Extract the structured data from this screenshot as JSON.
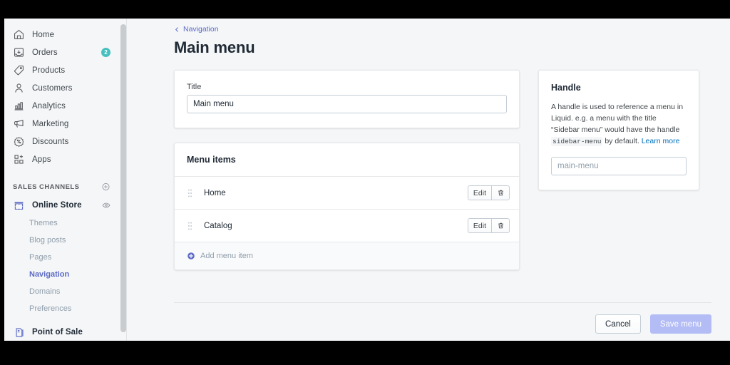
{
  "sidebar": {
    "nav_items": [
      {
        "label": "Home",
        "icon": "home-icon",
        "badge": null
      },
      {
        "label": "Orders",
        "icon": "orders-icon",
        "badge": "2"
      },
      {
        "label": "Products",
        "icon": "products-tag-icon",
        "badge": null
      },
      {
        "label": "Customers",
        "icon": "customers-icon",
        "badge": null
      },
      {
        "label": "Analytics",
        "icon": "analytics-bar-chart-icon",
        "badge": null
      },
      {
        "label": "Marketing",
        "icon": "marketing-megaphone-icon",
        "badge": null
      },
      {
        "label": "Discounts",
        "icon": "discounts-icon",
        "badge": null
      },
      {
        "label": "Apps",
        "icon": "apps-icon",
        "badge": null
      }
    ],
    "sales_channels_heading": "SALES CHANNELS",
    "online_store": {
      "label": "Online Store",
      "icon": "online-store-icon"
    },
    "sub_items": [
      {
        "label": "Themes",
        "active": false
      },
      {
        "label": "Blog posts",
        "active": false
      },
      {
        "label": "Pages",
        "active": false
      },
      {
        "label": "Navigation",
        "active": true
      },
      {
        "label": "Domains",
        "active": false
      },
      {
        "label": "Preferences",
        "active": false
      }
    ],
    "point_of_sale": {
      "label": "Point of Sale",
      "icon": "point-of-sale-icon"
    }
  },
  "header": {
    "breadcrumb": "Navigation",
    "page_title": "Main menu"
  },
  "title_card": {
    "label": "Title",
    "value": "Main menu",
    "placeholder": "Title"
  },
  "menu_items_card": {
    "heading": "Menu items",
    "rows": [
      {
        "label": "Home",
        "edit_label": "Edit"
      },
      {
        "label": "Catalog",
        "edit_label": "Edit"
      }
    ],
    "add_label": "Add menu item"
  },
  "handle_card": {
    "heading": "Handle",
    "description_part1": "A handle is used to reference a menu in Liquid. e.g. a menu with the title “Sidebar menu” would have the handle ",
    "description_code": "sidebar-menu",
    "description_part2": " by default. ",
    "learn_more": "Learn more",
    "input_value": "",
    "input_placeholder": "main-menu"
  },
  "footer": {
    "cancel_label": "Cancel",
    "save_label": "Save menu"
  },
  "colors": {
    "accent_indigo": "#5c6ac4",
    "badge_teal": "#47c1bf",
    "link_blue": "#006fbb",
    "save_disabled": "#b3bcf5",
    "page_bg": "#f4f6f8",
    "text_primary": "#212b36"
  }
}
